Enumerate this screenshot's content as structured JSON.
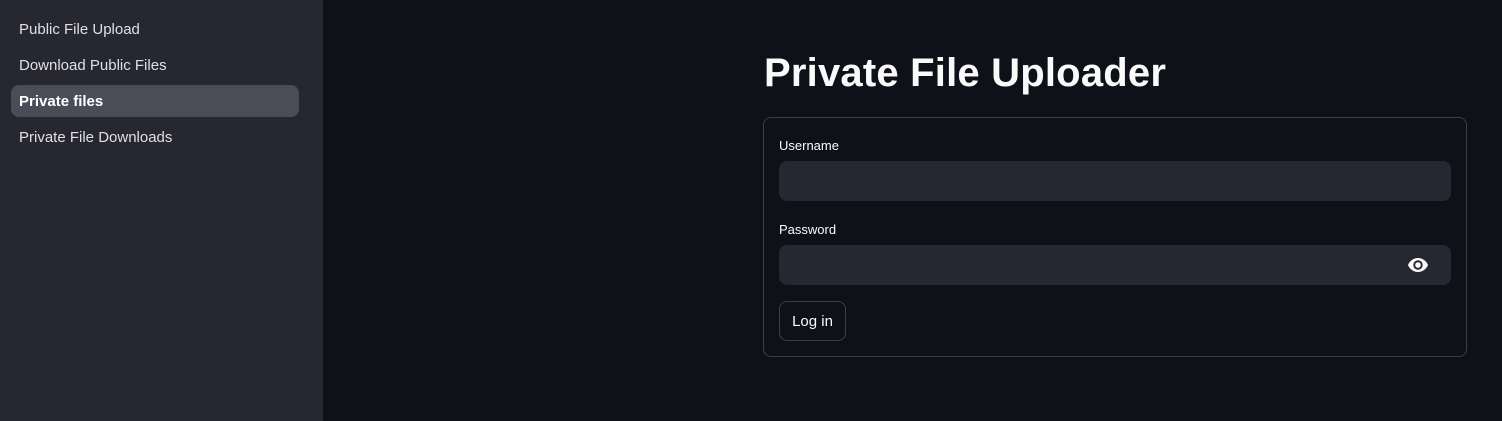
{
  "sidebar": {
    "items": [
      {
        "label": "Public File Upload"
      },
      {
        "label": "Download Public Files"
      },
      {
        "label": "Private files"
      },
      {
        "label": "Private File Downloads"
      }
    ]
  },
  "main": {
    "title": "Private File Uploader",
    "form": {
      "username_label": "Username",
      "username_value": "",
      "password_label": "Password",
      "password_value": "",
      "password_toggle_icon": "eye-icon",
      "login_label": "Log in"
    }
  },
  "colors": {
    "background": "#0e1117",
    "sidebar": "#262730",
    "active_item": "#4a4c58",
    "input": "#262730",
    "text": "#fafafa"
  }
}
